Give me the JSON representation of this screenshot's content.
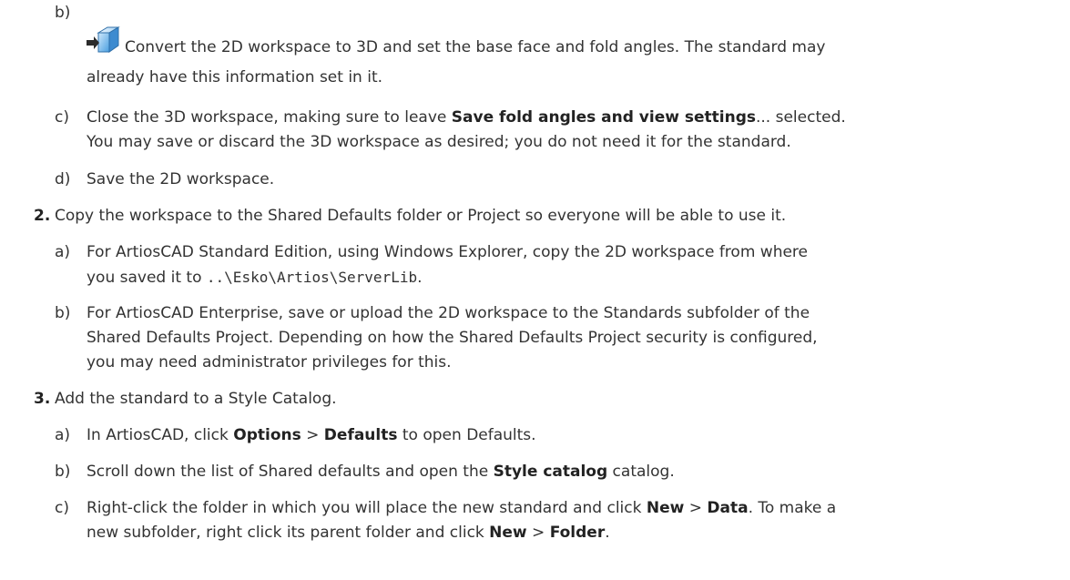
{
  "steps": {
    "step1": {
      "sub_b": {
        "marker": "b)",
        "icon": "convert-to-3d-icon",
        "text_1": "Convert the 2D workspace to 3D and set the base face and fold angles. The standard may",
        "text_2": "already have this information set in it."
      },
      "sub_c": {
        "marker": "c)",
        "text_1a": "Close the 3D workspace, making sure to leave ",
        "text_1b": "Save fold angles and view settings",
        "text_1c": "... selected.",
        "text_2": "You may save or discard the 3D workspace as desired; you do not need it for the standard."
      },
      "sub_d": {
        "marker": "d)",
        "text": "Save the 2D workspace."
      }
    },
    "step2": {
      "number": "2.",
      "text": "Copy the workspace to the Shared Defaults folder or Project so everyone will be able to use it.",
      "sub_a": {
        "marker": "a)",
        "text_1": "For ArtiosCAD Standard Edition, using Windows Explorer, copy the 2D workspace from where",
        "text_2a": "you saved it to ",
        "path": "..\\Esko\\Artios\\ServerLib",
        "text_2b": "."
      },
      "sub_b": {
        "marker": "b)",
        "text_1": "For ArtiosCAD Enterprise, save or upload the 2D workspace to the Standards subfolder of the",
        "text_2": "Shared Defaults Project. Depending on how the Shared Defaults Project security is configured,",
        "text_3": "you may need administrator privileges for this."
      }
    },
    "step3": {
      "number": "3.",
      "text": "Add the standard to a Style Catalog.",
      "sub_a": {
        "marker": "a)",
        "text_a": "In ArtiosCAD, click ",
        "options": "Options",
        "sep": " > ",
        "defaults": "Defaults",
        "text_b": " to open Defaults."
      },
      "sub_b": {
        "marker": "b)",
        "text_a": "Scroll down the list of Shared defaults and open the ",
        "style_catalog": "Style catalog",
        "text_b": " catalog."
      },
      "sub_c": {
        "marker": "c)",
        "text_1a": "Right-click the folder in which you will place the new standard and click ",
        "new1": "New",
        "sep1": " > ",
        "data": "Data",
        "text_1b": ". To make a",
        "text_2a": "new subfolder, right click its parent folder and click ",
        "new2": "New",
        "sep2": " > ",
        "folder": "Folder",
        "text_2b": "."
      }
    }
  }
}
